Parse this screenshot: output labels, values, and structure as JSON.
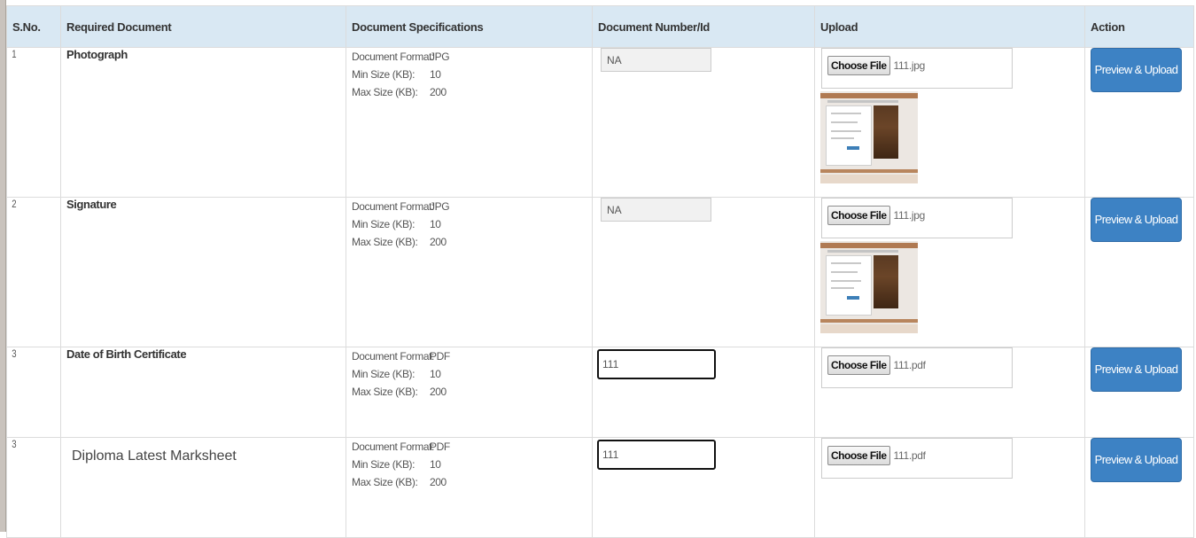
{
  "table": {
    "headers": {
      "sno": "S.No.",
      "document": "Required Document",
      "specs": "Document Specifications",
      "number": "Document Number/Id",
      "upload": "Upload",
      "action": "Action"
    },
    "spec_labels": {
      "format": "Document Format:",
      "min": "Min Size (KB):",
      "max": "Max Size (KB):"
    },
    "choose_file_label": "Choose File",
    "action_label": "Preview & Upload",
    "rows": [
      {
        "sno": "1",
        "document": "Photograph",
        "format": "JPG",
        "min": "10",
        "max": "200",
        "number": "NA",
        "file": "111.jpg"
      },
      {
        "sno": "2",
        "document": "Signature",
        "format": "JPG",
        "min": "10",
        "max": "200",
        "number": "NA",
        "file": "111.jpg"
      },
      {
        "sno": "3",
        "document": "Date of Birth Certificate",
        "format": "PDF",
        "min": "10",
        "max": "200",
        "number": "111",
        "file": "111.pdf"
      },
      {
        "sno": "3",
        "document": "Diploma Latest Marksheet",
        "format": "PDF",
        "min": "10",
        "max": "200",
        "number": "111",
        "file": "111.pdf"
      }
    ]
  },
  "colors": {
    "header_bg": "#d9e8f3",
    "button_bg": "#3d82c4"
  }
}
